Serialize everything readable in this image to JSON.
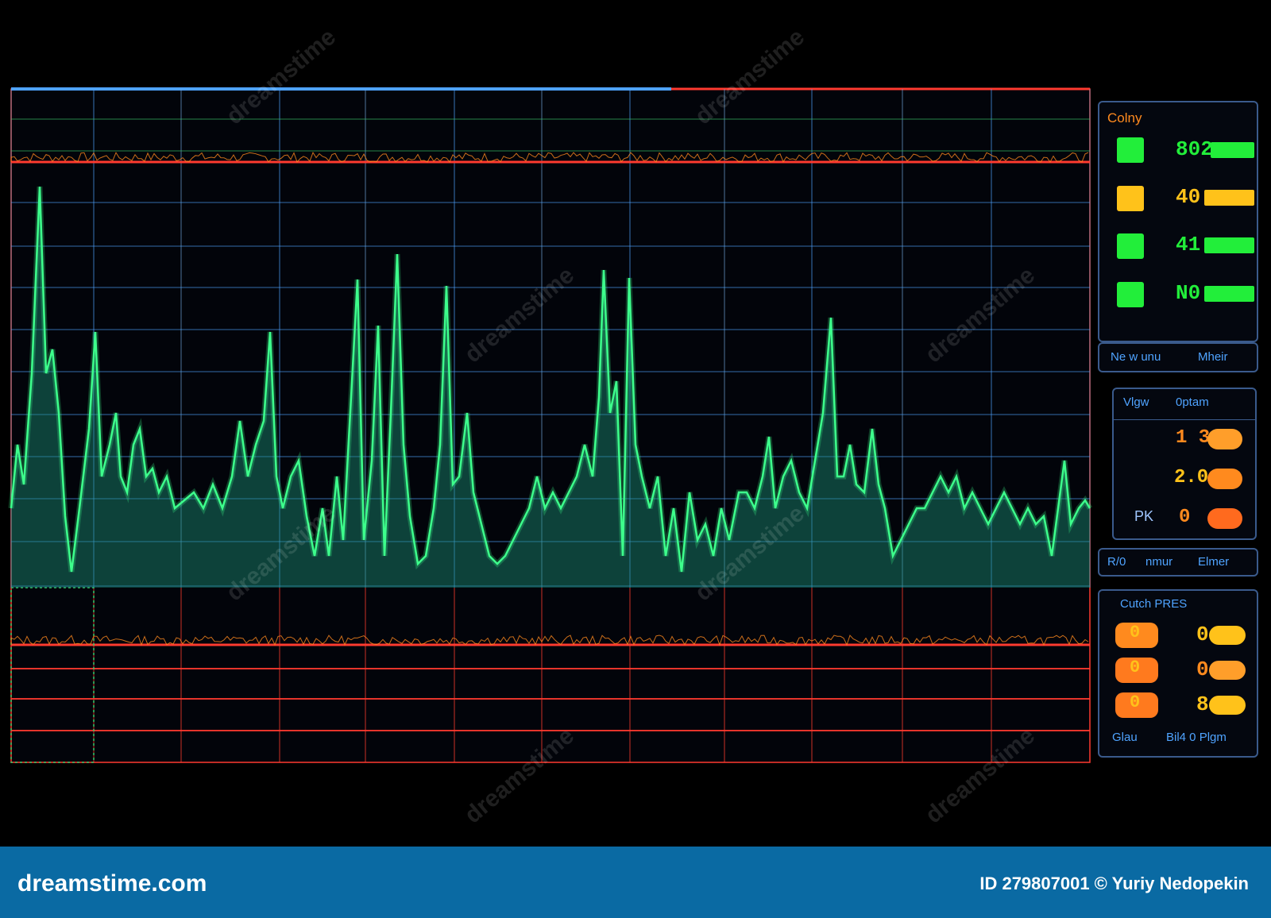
{
  "colors": {
    "signal": "#3dff8c",
    "signal_fill": "#1b8f76",
    "grid_blue": "#4fa3ff",
    "grid_red": "#ff3a2f",
    "grid_green": "#39c86a",
    "panel_border": "#3a5a8c",
    "accent_orange": "#ff8a1e",
    "accent_yellow": "#ffc21a",
    "footer_bg": "#0a6aa3"
  },
  "panel_top": {
    "title": "Colny",
    "rows": [
      {
        "value": "802",
        "color": "#22ee3a"
      },
      {
        "value": "40",
        "color": "#ffc21a"
      },
      {
        "value": "41",
        "color": "#22ee3a"
      },
      {
        "value": "N0",
        "color": "#22ee3a"
      }
    ],
    "footer_left": "Ne w unu",
    "footer_right": "Mheir"
  },
  "panel_mid": {
    "title_left": "Vlgw",
    "title_right": "0ptam",
    "side_label": "PK",
    "rows": [
      {
        "value": "1 3",
        "color": "#ff8a1e"
      },
      {
        "value": "2.0",
        "color": "#ffc21a"
      },
      {
        "value": "0",
        "color": "#ff8a1e"
      }
    ],
    "footer_left": "R/0",
    "footer_mid": "nmur",
    "footer_right": "Elmer"
  },
  "panel_bottom": {
    "title": "Cutch PRES",
    "rows": [
      {
        "left": "0",
        "right": "0"
      },
      {
        "left": "0",
        "right": "0"
      },
      {
        "left": "0",
        "right": "8"
      }
    ],
    "footer_left": "Glau",
    "footer_right": "Bil4 0 Plgm"
  },
  "footer": {
    "site": "dreamstime.com",
    "credit": "ID 279807001 © Yuriy Nedopekin"
  },
  "watermark": {
    "text": "dreamstime"
  }
}
